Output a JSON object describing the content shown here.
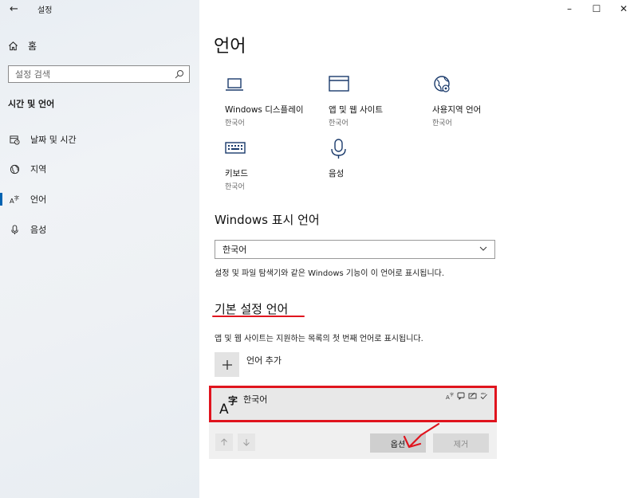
{
  "window": {
    "app_title": "설정",
    "back_glyph": "←",
    "minimize_glyph": "–",
    "maximize_glyph": "☐",
    "close_glyph": "✕"
  },
  "sidebar": {
    "home_label": "홈",
    "search_placeholder": "설정 검색",
    "section_title": "시간 및 언어",
    "items": [
      {
        "label": "날짜 및 시간",
        "icon": "calendar-clock-icon"
      },
      {
        "label": "지역",
        "icon": "globe-icon"
      },
      {
        "label": "언어",
        "icon": "language-icon",
        "active": true
      },
      {
        "label": "음성",
        "icon": "microphone-icon"
      }
    ]
  },
  "main": {
    "title": "언어",
    "tiles": [
      {
        "label": "Windows 디스플레이",
        "sub": "한국어",
        "icon": "laptop-icon"
      },
      {
        "label": "앱 및 웹 사이트",
        "sub": "한국어",
        "icon": "window-icon"
      },
      {
        "label": "사용지역 언어",
        "sub": "한국어",
        "icon": "globe-settings-icon"
      },
      {
        "label": "키보드",
        "sub": "한국어",
        "icon": "keyboard-icon"
      },
      {
        "label": "음성",
        "sub": "",
        "icon": "microphone-icon"
      }
    ],
    "display_language": {
      "heading": "Windows 표시 언어",
      "selected": "한국어",
      "description": "설정 및 파일 탐색기와 같은 Windows 기능이 이 언어로 표시됩니다."
    },
    "preferred": {
      "heading": "기본 설정 언어",
      "description": "앱 및 웹 사이트는 지원하는 목록의 첫 번째 언어로 표시됩니다.",
      "add_label": "언어 추가",
      "languages": [
        {
          "name": "한국어"
        }
      ],
      "options_label": "옵션",
      "remove_label": "제거"
    }
  },
  "colors": {
    "accent": "#0063b1",
    "annotation": "#e0141e"
  }
}
